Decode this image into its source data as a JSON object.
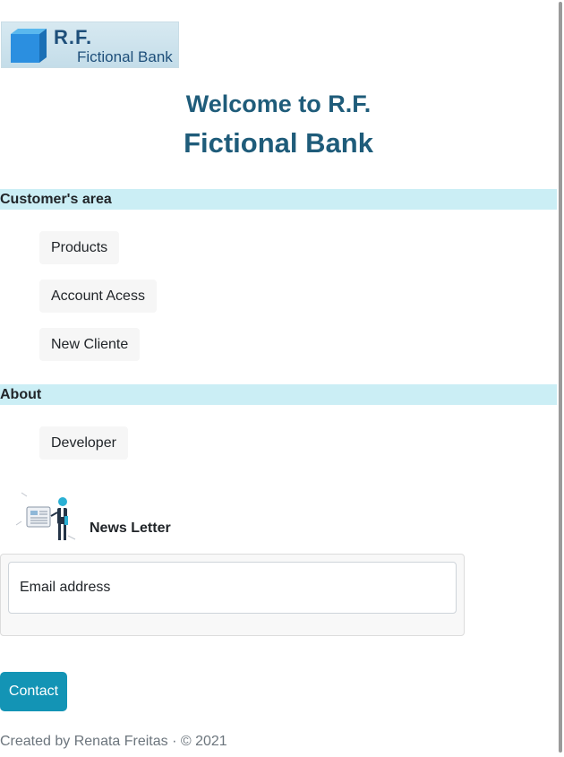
{
  "logo": {
    "line1": "R.F.",
    "line2": "Fictional Bank"
  },
  "title": {
    "line1": "Welcome to R.F.",
    "line2": "Fictional Bank"
  },
  "customer_area": {
    "header": "Customer's area",
    "items": [
      {
        "label": "Products"
      },
      {
        "label": "Account Acess"
      },
      {
        "label": "New Cliente"
      }
    ]
  },
  "about": {
    "header": "About",
    "items": [
      {
        "label": "Developer"
      }
    ]
  },
  "newsletter": {
    "label": "News Letter",
    "email_placeholder": "Email address"
  },
  "contact_label": "Contact",
  "footer": "Created by Renata Freitas · © 2021",
  "colors": {
    "title": "#1f5c7a",
    "section_header_bg": "#cbeef5",
    "contact_bg": "#1394b5",
    "nav_bg": "#f6f6f6"
  },
  "icons": {
    "logo": "blue-cube-icon",
    "newsletter": "newsletter-illustration"
  }
}
